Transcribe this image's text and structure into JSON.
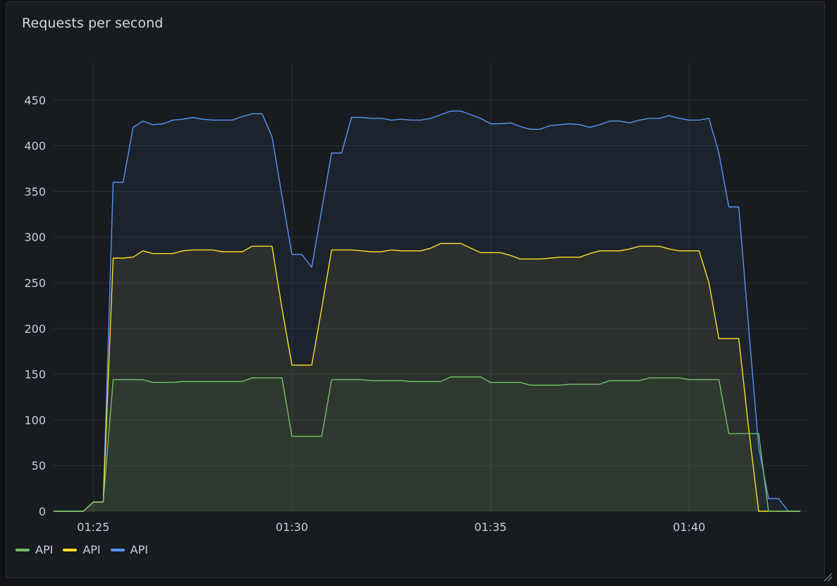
{
  "panel": {
    "title": "Requests per second"
  },
  "colors": {
    "green": "#73bf69",
    "yellow": "#fade2a",
    "blue": "#5794f2",
    "grid": "#2c2f34",
    "text": "#ccccdc"
  },
  "chart_data": {
    "type": "line",
    "title": "Requests per second",
    "ylim": [
      0,
      490
    ],
    "yticks": [
      0,
      50,
      100,
      150,
      200,
      250,
      300,
      350,
      400,
      450
    ],
    "xticks": [
      {
        "t": 5,
        "label": "01:25"
      },
      {
        "t": 10,
        "label": "01:30"
      },
      {
        "t": 15,
        "label": "01:35"
      },
      {
        "t": 20,
        "label": "01:40"
      }
    ],
    "xlim": [
      4,
      22.8
    ],
    "grid": true,
    "legend_position": "bottom-left",
    "series": [
      {
        "name": "API",
        "color": "#5794f2",
        "points": [
          [
            4,
            0
          ],
          [
            4.75,
            0
          ],
          [
            5,
            10
          ],
          [
            5.25,
            10
          ],
          [
            5.5,
            360
          ],
          [
            5.75,
            360
          ],
          [
            6,
            420
          ],
          [
            6.25,
            427
          ],
          [
            6.5,
            423
          ],
          [
            6.75,
            424
          ],
          [
            7,
            428
          ],
          [
            7.25,
            429
          ],
          [
            7.5,
            431
          ],
          [
            7.75,
            429
          ],
          [
            8,
            428
          ],
          [
            8.25,
            428
          ],
          [
            8.5,
            428
          ],
          [
            8.75,
            432
          ],
          [
            9,
            435
          ],
          [
            9.25,
            435
          ],
          [
            9.5,
            410
          ],
          [
            9.75,
            345
          ],
          [
            10,
            281
          ],
          [
            10.25,
            281
          ],
          [
            10.5,
            267
          ],
          [
            10.75,
            330
          ],
          [
            11,
            392
          ],
          [
            11.25,
            392
          ],
          [
            11.5,
            431
          ],
          [
            11.75,
            431
          ],
          [
            12,
            430
          ],
          [
            12.25,
            430
          ],
          [
            12.5,
            428
          ],
          [
            12.75,
            429
          ],
          [
            13,
            428
          ],
          [
            13.25,
            428
          ],
          [
            13.5,
            430
          ],
          [
            13.75,
            434
          ],
          [
            14,
            438
          ],
          [
            14.25,
            438
          ],
          [
            14.5,
            434
          ],
          [
            14.75,
            430
          ],
          [
            15,
            424
          ],
          [
            15.25,
            424
          ],
          [
            15.5,
            425
          ],
          [
            15.75,
            421
          ],
          [
            16,
            418
          ],
          [
            16.25,
            418
          ],
          [
            16.5,
            422
          ],
          [
            16.75,
            423
          ],
          [
            17,
            424
          ],
          [
            17.25,
            423
          ],
          [
            17.5,
            420
          ],
          [
            17.75,
            423
          ],
          [
            18,
            427
          ],
          [
            18.25,
            427
          ],
          [
            18.5,
            425
          ],
          [
            18.75,
            428
          ],
          [
            19,
            430
          ],
          [
            19.25,
            430
          ],
          [
            19.5,
            433
          ],
          [
            19.75,
            430
          ],
          [
            20,
            428
          ],
          [
            20.25,
            428
          ],
          [
            20.5,
            430
          ],
          [
            20.75,
            392
          ],
          [
            21,
            333
          ],
          [
            21.25,
            333
          ],
          [
            21.5,
            200
          ],
          [
            21.75,
            70
          ],
          [
            22,
            14
          ],
          [
            22.25,
            14
          ],
          [
            22.5,
            0
          ],
          [
            22.8,
            0
          ]
        ]
      },
      {
        "name": "API",
        "color": "#fade2a",
        "points": [
          [
            4,
            0
          ],
          [
            4.75,
            0
          ],
          [
            5,
            10
          ],
          [
            5.25,
            10
          ],
          [
            5.5,
            277
          ],
          [
            5.75,
            277
          ],
          [
            6,
            278
          ],
          [
            6.25,
            285
          ],
          [
            6.5,
            282
          ],
          [
            6.75,
            282
          ],
          [
            7,
            282
          ],
          [
            7.25,
            285
          ],
          [
            7.5,
            286
          ],
          [
            7.75,
            286
          ],
          [
            8,
            286
          ],
          [
            8.25,
            284
          ],
          [
            8.5,
            284
          ],
          [
            8.75,
            284
          ],
          [
            9,
            290
          ],
          [
            9.25,
            290
          ],
          [
            9.5,
            290
          ],
          [
            9.75,
            222
          ],
          [
            10,
            160
          ],
          [
            10.25,
            160
          ],
          [
            10.5,
            160
          ],
          [
            10.75,
            222
          ],
          [
            11,
            286
          ],
          [
            11.25,
            286
          ],
          [
            11.5,
            286
          ],
          [
            11.75,
            285
          ],
          [
            12,
            284
          ],
          [
            12.25,
            284
          ],
          [
            12.5,
            286
          ],
          [
            12.75,
            285
          ],
          [
            13,
            285
          ],
          [
            13.25,
            285
          ],
          [
            13.5,
            288
          ],
          [
            13.75,
            293
          ],
          [
            14,
            293
          ],
          [
            14.25,
            293
          ],
          [
            14.5,
            288
          ],
          [
            14.75,
            283
          ],
          [
            15,
            283
          ],
          [
            15.25,
            283
          ],
          [
            15.5,
            280
          ],
          [
            15.75,
            276
          ],
          [
            16,
            276
          ],
          [
            16.25,
            276
          ],
          [
            16.5,
            277
          ],
          [
            16.75,
            278
          ],
          [
            17,
            278
          ],
          [
            17.25,
            278
          ],
          [
            17.5,
            282
          ],
          [
            17.75,
            285
          ],
          [
            18,
            285
          ],
          [
            18.25,
            285
          ],
          [
            18.5,
            287
          ],
          [
            18.75,
            290
          ],
          [
            19,
            290
          ],
          [
            19.25,
            290
          ],
          [
            19.5,
            287
          ],
          [
            19.75,
            285
          ],
          [
            20,
            285
          ],
          [
            20.25,
            285
          ],
          [
            20.5,
            250
          ],
          [
            20.75,
            189
          ],
          [
            21,
            189
          ],
          [
            21.25,
            189
          ],
          [
            21.5,
            90
          ],
          [
            21.75,
            0
          ],
          [
            22,
            0
          ],
          [
            22.25,
            0
          ],
          [
            22.5,
            0
          ],
          [
            22.8,
            0
          ]
        ]
      },
      {
        "name": "API",
        "color": "#73bf69",
        "points": [
          [
            4,
            0
          ],
          [
            4.75,
            0
          ],
          [
            5,
            10
          ],
          [
            5.25,
            10
          ],
          [
            5.5,
            144
          ],
          [
            5.75,
            144
          ],
          [
            6,
            144
          ],
          [
            6.25,
            144
          ],
          [
            6.5,
            141
          ],
          [
            6.75,
            141
          ],
          [
            7,
            141
          ],
          [
            7.25,
            142
          ],
          [
            7.5,
            142
          ],
          [
            7.75,
            142
          ],
          [
            8,
            142
          ],
          [
            8.25,
            142
          ],
          [
            8.5,
            142
          ],
          [
            8.75,
            142
          ],
          [
            9,
            146
          ],
          [
            9.25,
            146
          ],
          [
            9.5,
            146
          ],
          [
            9.75,
            146
          ],
          [
            10,
            82
          ],
          [
            10.25,
            82
          ],
          [
            10.5,
            82
          ],
          [
            10.75,
            82
          ],
          [
            11,
            144
          ],
          [
            11.25,
            144
          ],
          [
            11.5,
            144
          ],
          [
            11.75,
            144
          ],
          [
            12,
            143
          ],
          [
            12.25,
            143
          ],
          [
            12.5,
            143
          ],
          [
            12.75,
            143
          ],
          [
            13,
            142
          ],
          [
            13.25,
            142
          ],
          [
            13.5,
            142
          ],
          [
            13.75,
            142
          ],
          [
            14,
            147
          ],
          [
            14.25,
            147
          ],
          [
            14.5,
            147
          ],
          [
            14.75,
            147
          ],
          [
            15,
            141
          ],
          [
            15.25,
            141
          ],
          [
            15.5,
            141
          ],
          [
            15.75,
            141
          ],
          [
            16,
            138
          ],
          [
            16.25,
            138
          ],
          [
            16.5,
            138
          ],
          [
            16.75,
            138
          ],
          [
            17,
            139
          ],
          [
            17.25,
            139
          ],
          [
            17.5,
            139
          ],
          [
            17.75,
            139
          ],
          [
            18,
            143
          ],
          [
            18.25,
            143
          ],
          [
            18.5,
            143
          ],
          [
            18.75,
            143
          ],
          [
            19,
            146
          ],
          [
            19.25,
            146
          ],
          [
            19.5,
            146
          ],
          [
            19.75,
            146
          ],
          [
            20,
            144
          ],
          [
            20.25,
            144
          ],
          [
            20.5,
            144
          ],
          [
            20.75,
            144
          ],
          [
            21,
            85
          ],
          [
            21.25,
            85
          ],
          [
            21.5,
            85
          ],
          [
            21.75,
            85
          ],
          [
            22,
            0
          ],
          [
            22.25,
            0
          ],
          [
            22.5,
            0
          ],
          [
            22.8,
            0
          ]
        ]
      }
    ]
  },
  "legend": [
    {
      "label": "API",
      "color": "#73bf69"
    },
    {
      "label": "API",
      "color": "#fade2a"
    },
    {
      "label": "API",
      "color": "#5794f2"
    }
  ]
}
